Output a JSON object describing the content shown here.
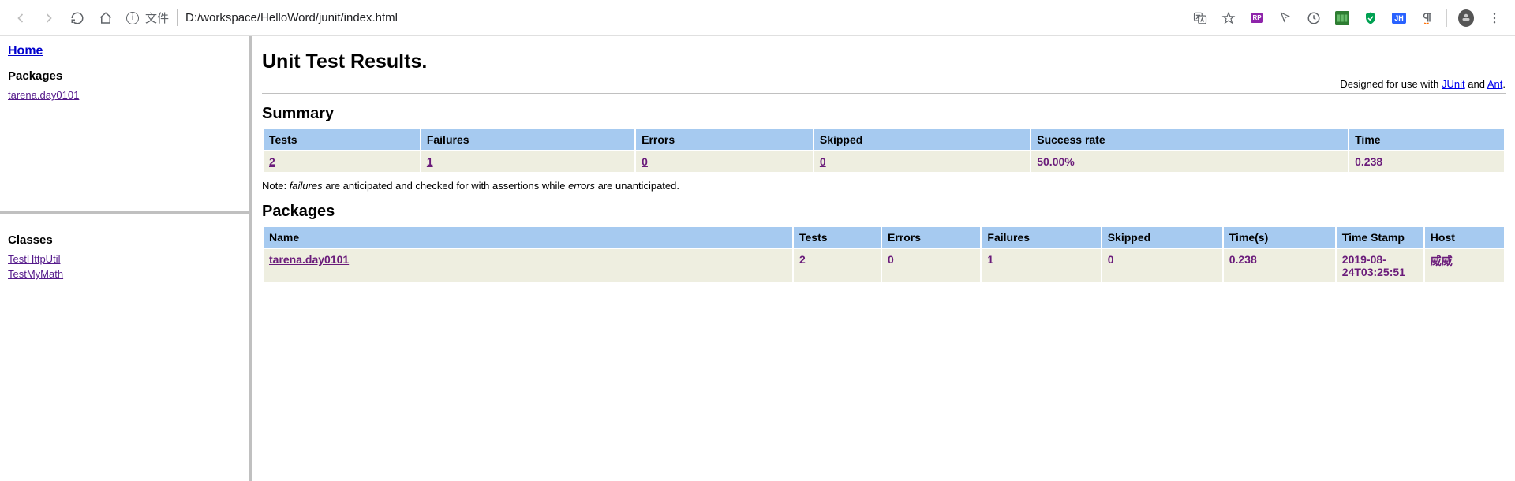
{
  "browser": {
    "file_label": "文件",
    "url": "D:/workspace/HelloWord/junit/index.html"
  },
  "sidebar_top": {
    "home_label": "Home",
    "packages_heading": "Packages",
    "packages": [
      "tarena.day0101"
    ]
  },
  "sidebar_bottom": {
    "classes_heading": "Classes",
    "classes": [
      "TestHttpUtil",
      "TestMyMath"
    ]
  },
  "main": {
    "title": "Unit Test Results.",
    "designed_prefix": "Designed for use with ",
    "designed_link1": "JUnit",
    "designed_and": " and ",
    "designed_link2": "Ant",
    "summary_heading": "Summary",
    "summary_headers": {
      "tests": "Tests",
      "failures": "Failures",
      "errors": "Errors",
      "skipped": "Skipped",
      "success": "Success rate",
      "time": "Time"
    },
    "summary_values": {
      "tests": "2",
      "failures": "1",
      "errors": "0",
      "skipped": "0",
      "success": "50.00%",
      "time": "0.238"
    },
    "note_prefix": "Note: ",
    "note_failures": "failures",
    "note_mid": " are anticipated and checked for with assertions while ",
    "note_errors": "errors",
    "note_end": " are unanticipated.",
    "packages_heading": "Packages",
    "pkg_headers": {
      "name": "Name",
      "tests": "Tests",
      "errors": "Errors",
      "failures": "Failures",
      "skipped": "Skipped",
      "time": "Time(s)",
      "timestamp": "Time Stamp",
      "host": "Host"
    },
    "pkg_row": {
      "name": "tarena.day0101",
      "tests": "2",
      "errors": "0",
      "failures": "1",
      "skipped": "0",
      "time": "0.238",
      "timestamp": "2019-08-24T03:25:51",
      "host": "威威"
    }
  }
}
